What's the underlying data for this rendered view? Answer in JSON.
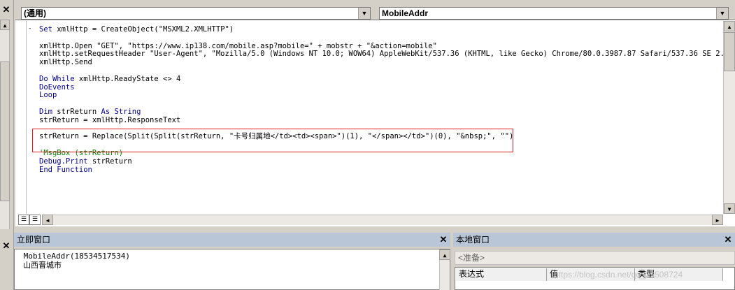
{
  "object_combo": "(通用)",
  "procedure_combo": "MobileAddr",
  "code_lines": [
    {
      "parts": [
        {
          "t": "Set ",
          "c": "kw"
        },
        {
          "t": "xmlHttp = CreateObject(\"MSXML2.XMLHTTP\")",
          "c": ""
        }
      ]
    },
    {
      "parts": [
        {
          "t": "",
          "c": ""
        }
      ]
    },
    {
      "parts": [
        {
          "t": "xmlHttp.Open \"GET\", \"https://www.ip138.com/mobile.asp?mobile=\" + mobstr + \"&action=mobile\"",
          "c": ""
        }
      ]
    },
    {
      "parts": [
        {
          "t": "xmlHttp.setRequestHeader \"User-Agent\", \"Mozilla/5.0 (Windows NT 10.0; WOW64) AppleWebKit/537.36 (KHTML, like Gecko) Chrome/80.0.3987.87 Safari/537.36 SE 2.X MetaSr",
          "c": ""
        }
      ]
    },
    {
      "parts": [
        {
          "t": "xmlHttp.Send",
          "c": ""
        }
      ]
    },
    {
      "parts": [
        {
          "t": "",
          "c": ""
        }
      ]
    },
    {
      "parts": [
        {
          "t": "Do While ",
          "c": "kw"
        },
        {
          "t": "xmlHttp.ReadyState <> 4",
          "c": ""
        }
      ]
    },
    {
      "parts": [
        {
          "t": "DoEvents",
          "c": "kw"
        }
      ]
    },
    {
      "parts": [
        {
          "t": "Loop",
          "c": "kw"
        }
      ]
    },
    {
      "parts": [
        {
          "t": "",
          "c": ""
        }
      ]
    },
    {
      "parts": [
        {
          "t": "Dim ",
          "c": "kw"
        },
        {
          "t": "strReturn ",
          "c": ""
        },
        {
          "t": "As String",
          "c": "kw"
        }
      ]
    },
    {
      "parts": [
        {
          "t": "strReturn = xmlHttp.ResponseText",
          "c": ""
        }
      ]
    },
    {
      "parts": [
        {
          "t": "",
          "c": ""
        }
      ]
    },
    {
      "parts": [
        {
          "t": "strReturn = Replace(Split(Split(strReturn, \"卡号归属地</td><td><span>\")(1), \"</span></td>\")(0), \"&nbsp;\", \"\")",
          "c": ""
        }
      ]
    },
    {
      "parts": [
        {
          "t": "",
          "c": ""
        }
      ]
    },
    {
      "parts": [
        {
          "t": "'MsgBox (strReturn)",
          "c": "cm"
        }
      ]
    },
    {
      "parts": [
        {
          "t": "Debug.Print ",
          "c": "kw"
        },
        {
          "t": "strReturn",
          "c": ""
        }
      ]
    },
    {
      "parts": [
        {
          "t": "End Function",
          "c": "kw"
        }
      ]
    }
  ],
  "immediate": {
    "title": "立即窗口",
    "lines": [
      " MobileAddr(18534517534)",
      "山西晋城市"
    ]
  },
  "locals": {
    "title": "本地窗口",
    "status": "<准备>",
    "columns": [
      "表达式",
      "值",
      "类型"
    ],
    "watermark": "https://blog.csdn.net/qq_39508724"
  },
  "icons": {
    "close": "✕",
    "arrow_down": "▼",
    "arrow_up": "▲",
    "arrow_left": "◀",
    "arrow_right": "▶"
  }
}
